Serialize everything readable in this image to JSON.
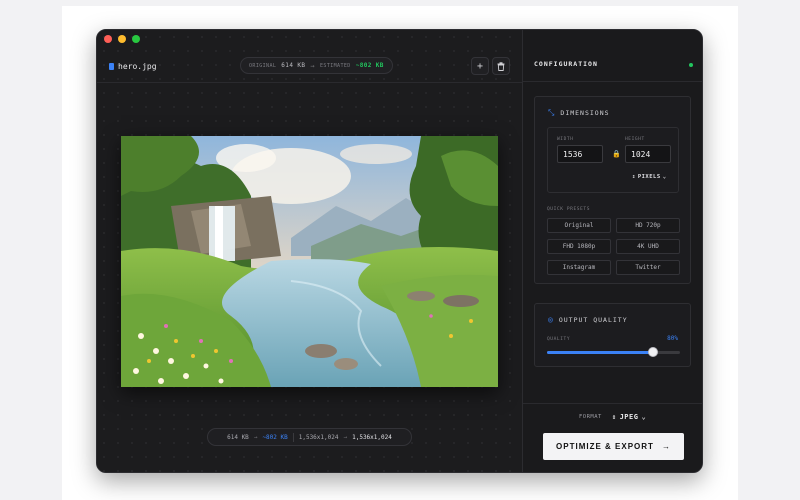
{
  "editor": {
    "file_name": "hero.jpg",
    "original_label": "ORIGINAL",
    "original_size": "614 KB",
    "arrow": "→",
    "estimated_label": "ESTIMATED",
    "estimated_size": "~802 KB",
    "add_icon": "+",
    "delete_icon": "🗑"
  },
  "stats": {
    "size_from": "614 KB",
    "size_to": "~802 KB",
    "dims_from": "1,536x1,024",
    "dims_to": "1,536x1,024",
    "arrow": "→"
  },
  "config": {
    "title": "CONFIGURATION",
    "dimensions": {
      "title": "DIMENSIONS",
      "width_label": "WIDTH",
      "width_value": "1536",
      "height_label": "HEIGHT",
      "height_value": "1024",
      "unit": "PIXELS",
      "presets_label": "QUICK PRESETS",
      "presets": [
        "Original",
        "HD 720p",
        "FHD 1080p",
        "4K UHD",
        "Instagram",
        "Twitter"
      ]
    },
    "quality": {
      "title": "OUTPUT QUALITY",
      "label": "QUALITY",
      "value_text": "80%",
      "value": 0.8
    },
    "format_label": "FORMAT",
    "format_value": "JPEG",
    "export_label": "OPTIMIZE & EXPORT",
    "export_arrow": "→"
  },
  "colors": {
    "accent": "#3b82f6",
    "success": "#22c55e"
  }
}
